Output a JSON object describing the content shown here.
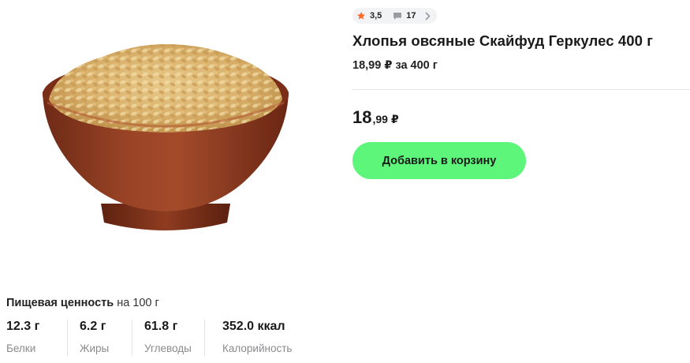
{
  "product": {
    "title": "Хлопья овсяные Скайфуд Геркулес 400 г",
    "unit_price": "18,99 ₽",
    "unit_per": "за 400 г",
    "price_int": "18",
    "price_frac": ",99",
    "currency": "₽",
    "add_to_cart": "Добавить в корзину"
  },
  "rating": {
    "value": "3,5",
    "reviews": "17"
  },
  "nutrition": {
    "title": "Пищевая ценность",
    "per": "на 100 г",
    "items": [
      {
        "value": "12.3 г",
        "label": "Белки"
      },
      {
        "value": "6.2 г",
        "label": "Жиры"
      },
      {
        "value": "61.8 г",
        "label": "Углеводы"
      },
      {
        "value": "352.0 ккал",
        "label": "Калорийность"
      }
    ]
  },
  "colors": {
    "accent": "#5df57a",
    "star": "#ff6a2b",
    "chip_bg": "#f2f3f5"
  }
}
